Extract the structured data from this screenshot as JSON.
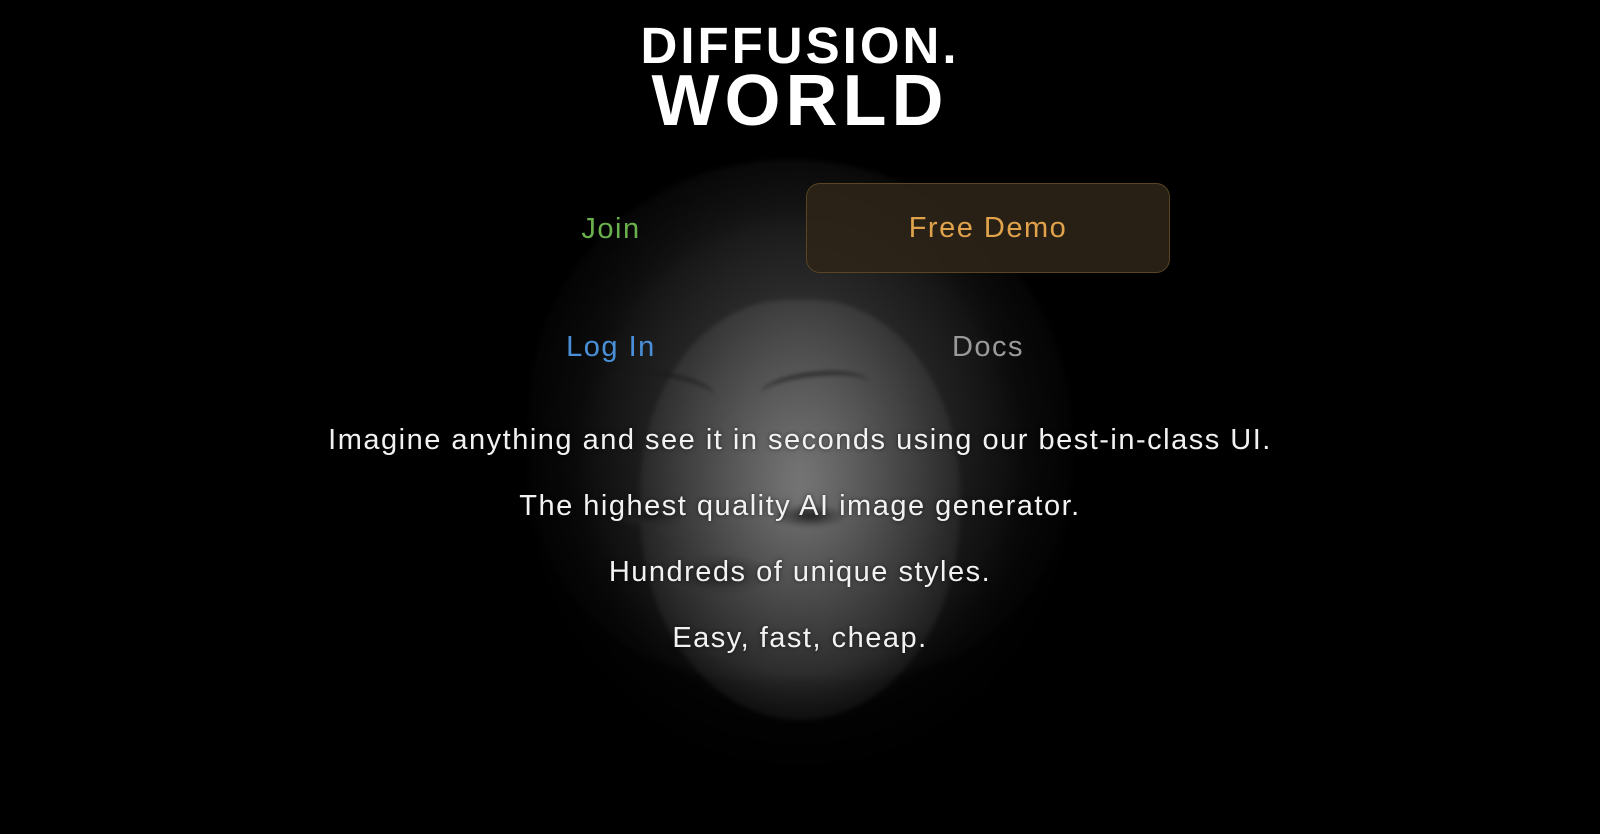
{
  "brand": {
    "line1": "DIFFUSION.",
    "line2": "WORLD"
  },
  "nav": {
    "join_label": "Join",
    "free_demo_label": "Free Demo",
    "login_label": "Log In",
    "docs_label": "Docs"
  },
  "taglines": [
    "Imagine anything and see it in seconds using our best-in-class UI.",
    "The highest quality AI image generator.",
    "Hundreds of unique styles.",
    "Easy, fast, cheap."
  ],
  "colors": {
    "background": "#000000",
    "join": "#6ab04c",
    "free_demo": "#e0a24a",
    "login": "#4a90d9",
    "docs": "#9a9a9a",
    "text": "#f2f2f2"
  },
  "background_image": {
    "subject": "portrait-photo"
  }
}
